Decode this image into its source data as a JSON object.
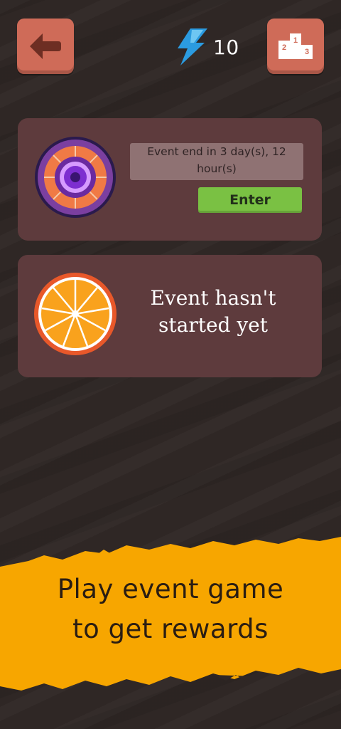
{
  "header": {
    "energy_count": "10",
    "podium_labels": [
      "2",
      "1",
      "3"
    ],
    "icons": {
      "back": "arrow-left-icon",
      "energy": "lightning-bolt-icon",
      "leaderboard": "podium-icon"
    }
  },
  "events": [
    {
      "icon": "purple-orange-wheel-icon",
      "timer_text": "Event end in 3 day(s), 12 hour(s)",
      "enter_label": "Enter"
    },
    {
      "icon": "orange-slice-icon",
      "status_text": "Event hasn't started yet"
    }
  ],
  "banner": {
    "line1": "Play event game",
    "line2": "to get rewards"
  },
  "colors": {
    "background": "#2f2725",
    "card": "#5e3b3d",
    "button": "#cf6b58",
    "enter_green": "#7ac143",
    "banner_orange": "#f7a600",
    "bolt_blue": "#2b9be0"
  }
}
